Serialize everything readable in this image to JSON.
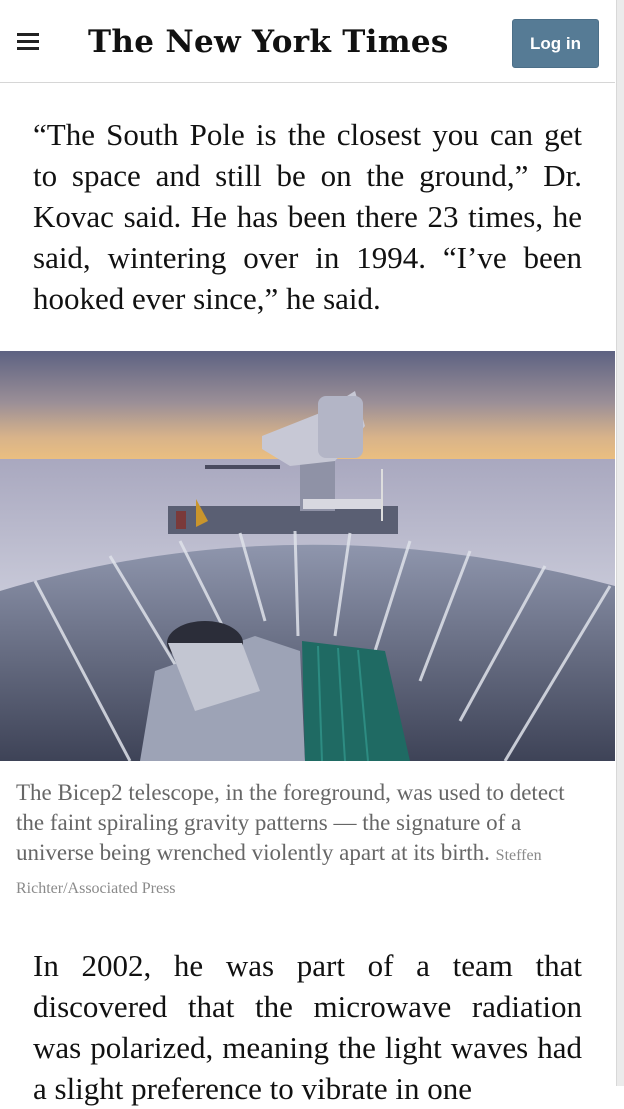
{
  "header": {
    "masthead": "The New York Times",
    "login_label": "Log in"
  },
  "article": {
    "paragraph_1": "“The South Pole is the closest you can get to space and still be on the ground,” Dr. Kovac said. He has been there 23 times, he said, wintering over in 1994. “I’ve been hooked ever since,” he said.",
    "photo": {
      "caption": "The Bicep2 telescope, in the foreground, was used to detect the faint spiraling gravity patterns — the signature of a universe being wrenched violently apart at its birth.",
      "credit": "Steffen Richter/Associated Press"
    },
    "paragraph_2": "In 2002, he was part of a team that discovered that the microwave radiation was polarized, meaning the light waves had a slight preference to vibrate in one"
  },
  "colors": {
    "login_button": "#567b95",
    "caption_text": "#666666",
    "body_text": "#111111"
  },
  "icons": {
    "menu": "hamburger-menu-icon"
  }
}
